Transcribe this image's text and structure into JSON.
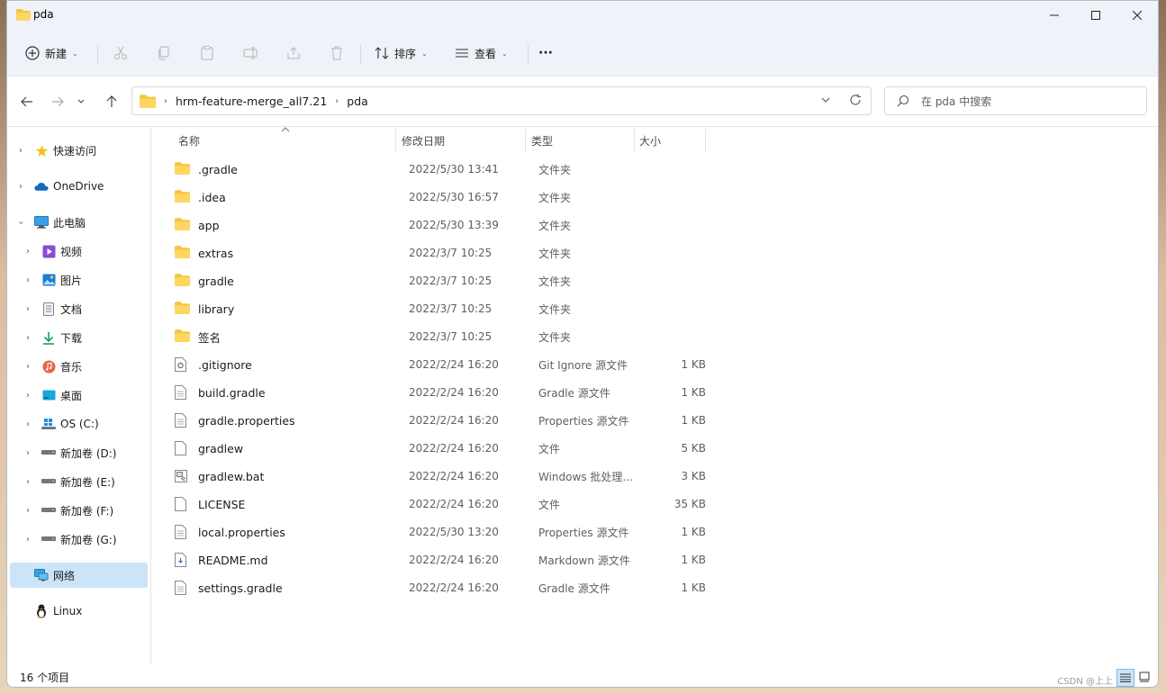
{
  "window": {
    "title": "pda"
  },
  "toolbar": {
    "new_label": "新建",
    "sort_label": "排序",
    "view_label": "查看",
    "more_label": "···"
  },
  "address": {
    "segments": [
      "hrm-feature-merge_all7.21",
      "pda"
    ]
  },
  "search": {
    "placeholder": "在 pda 中搜索"
  },
  "sidebar": {
    "items": [
      {
        "label": "快速访问",
        "icon": "star-icon"
      },
      {
        "label": "OneDrive",
        "icon": "cloud-icon"
      },
      {
        "label": "此电脑",
        "icon": "pc-icon"
      },
      {
        "label": "视频",
        "icon": "video-icon"
      },
      {
        "label": "图片",
        "icon": "picture-icon"
      },
      {
        "label": "文档",
        "icon": "document-icon"
      },
      {
        "label": "下载",
        "icon": "download-icon"
      },
      {
        "label": "音乐",
        "icon": "music-icon"
      },
      {
        "label": "桌面",
        "icon": "desktop-icon"
      },
      {
        "label": "OS (C:)",
        "icon": "windows-drive-icon"
      },
      {
        "label": "新加卷 (D:)",
        "icon": "drive-icon"
      },
      {
        "label": "新加卷 (E:)",
        "icon": "drive-icon"
      },
      {
        "label": "新加卷 (F:)",
        "icon": "drive-icon"
      },
      {
        "label": "新加卷 (G:)",
        "icon": "drive-icon"
      },
      {
        "label": "网络",
        "icon": "network-icon"
      },
      {
        "label": "Linux",
        "icon": "linux-icon"
      }
    ]
  },
  "columns": {
    "name": "名称",
    "date": "修改日期",
    "type": "类型",
    "size": "大小"
  },
  "files": [
    {
      "name": ".gradle",
      "date": "2022/5/30 13:41",
      "type": "文件夹",
      "size": "",
      "kind": "folder"
    },
    {
      "name": ".idea",
      "date": "2022/5/30 16:57",
      "type": "文件夹",
      "size": "",
      "kind": "folder"
    },
    {
      "name": "app",
      "date": "2022/5/30 13:39",
      "type": "文件夹",
      "size": "",
      "kind": "folder"
    },
    {
      "name": "extras",
      "date": "2022/3/7 10:25",
      "type": "文件夹",
      "size": "",
      "kind": "folder"
    },
    {
      "name": "gradle",
      "date": "2022/3/7 10:25",
      "type": "文件夹",
      "size": "",
      "kind": "folder"
    },
    {
      "name": "library",
      "date": "2022/3/7 10:25",
      "type": "文件夹",
      "size": "",
      "kind": "folder"
    },
    {
      "name": "签名",
      "date": "2022/3/7 10:25",
      "type": "文件夹",
      "size": "",
      "kind": "folder"
    },
    {
      "name": ".gitignore",
      "date": "2022/2/24 16:20",
      "type": "Git Ignore 源文件",
      "size": "1 KB",
      "kind": "config"
    },
    {
      "name": "build.gradle",
      "date": "2022/2/24 16:20",
      "type": "Gradle 源文件",
      "size": "1 KB",
      "kind": "text"
    },
    {
      "name": "gradle.properties",
      "date": "2022/2/24 16:20",
      "type": "Properties 源文件",
      "size": "1 KB",
      "kind": "text"
    },
    {
      "name": "gradlew",
      "date": "2022/2/24 16:20",
      "type": "文件",
      "size": "5 KB",
      "kind": "blank"
    },
    {
      "name": "gradlew.bat",
      "date": "2022/2/24 16:20",
      "type": "Windows 批处理...",
      "size": "3 KB",
      "kind": "bat"
    },
    {
      "name": "LICENSE",
      "date": "2022/2/24 16:20",
      "type": "文件",
      "size": "35 KB",
      "kind": "blank"
    },
    {
      "name": "local.properties",
      "date": "2022/5/30 13:20",
      "type": "Properties 源文件",
      "size": "1 KB",
      "kind": "text"
    },
    {
      "name": "README.md",
      "date": "2022/2/24 16:20",
      "type": "Markdown 源文件",
      "size": "1 KB",
      "kind": "md"
    },
    {
      "name": "settings.gradle",
      "date": "2022/2/24 16:20",
      "type": "Gradle 源文件",
      "size": "1 KB",
      "kind": "text"
    }
  ],
  "status": {
    "count_text": "16 个项目",
    "watermark": "CSDN @上上"
  },
  "colors": {
    "folder": "#f4c542",
    "selected_bg": "#cce4f7",
    "chrome_bg": "#edf3f8"
  }
}
